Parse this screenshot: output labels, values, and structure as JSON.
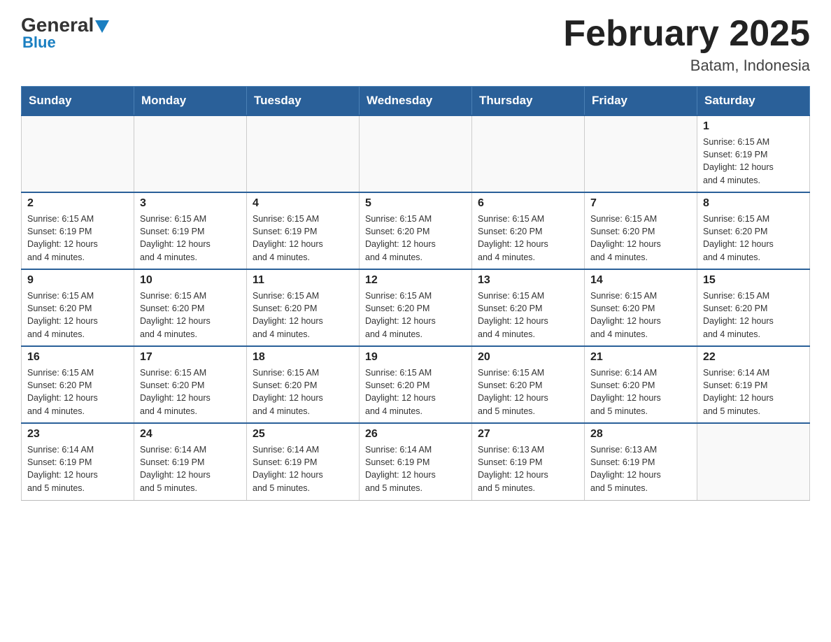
{
  "header": {
    "logo_general": "General",
    "logo_blue": "Blue",
    "month_title": "February 2025",
    "location": "Batam, Indonesia"
  },
  "days_of_week": [
    "Sunday",
    "Monday",
    "Tuesday",
    "Wednesday",
    "Thursday",
    "Friday",
    "Saturday"
  ],
  "weeks": [
    [
      {
        "day": "",
        "info": ""
      },
      {
        "day": "",
        "info": ""
      },
      {
        "day": "",
        "info": ""
      },
      {
        "day": "",
        "info": ""
      },
      {
        "day": "",
        "info": ""
      },
      {
        "day": "",
        "info": ""
      },
      {
        "day": "1",
        "info": "Sunrise: 6:15 AM\nSunset: 6:19 PM\nDaylight: 12 hours\nand 4 minutes."
      }
    ],
    [
      {
        "day": "2",
        "info": "Sunrise: 6:15 AM\nSunset: 6:19 PM\nDaylight: 12 hours\nand 4 minutes."
      },
      {
        "day": "3",
        "info": "Sunrise: 6:15 AM\nSunset: 6:19 PM\nDaylight: 12 hours\nand 4 minutes."
      },
      {
        "day": "4",
        "info": "Sunrise: 6:15 AM\nSunset: 6:19 PM\nDaylight: 12 hours\nand 4 minutes."
      },
      {
        "day": "5",
        "info": "Sunrise: 6:15 AM\nSunset: 6:20 PM\nDaylight: 12 hours\nand 4 minutes."
      },
      {
        "day": "6",
        "info": "Sunrise: 6:15 AM\nSunset: 6:20 PM\nDaylight: 12 hours\nand 4 minutes."
      },
      {
        "day": "7",
        "info": "Sunrise: 6:15 AM\nSunset: 6:20 PM\nDaylight: 12 hours\nand 4 minutes."
      },
      {
        "day": "8",
        "info": "Sunrise: 6:15 AM\nSunset: 6:20 PM\nDaylight: 12 hours\nand 4 minutes."
      }
    ],
    [
      {
        "day": "9",
        "info": "Sunrise: 6:15 AM\nSunset: 6:20 PM\nDaylight: 12 hours\nand 4 minutes."
      },
      {
        "day": "10",
        "info": "Sunrise: 6:15 AM\nSunset: 6:20 PM\nDaylight: 12 hours\nand 4 minutes."
      },
      {
        "day": "11",
        "info": "Sunrise: 6:15 AM\nSunset: 6:20 PM\nDaylight: 12 hours\nand 4 minutes."
      },
      {
        "day": "12",
        "info": "Sunrise: 6:15 AM\nSunset: 6:20 PM\nDaylight: 12 hours\nand 4 minutes."
      },
      {
        "day": "13",
        "info": "Sunrise: 6:15 AM\nSunset: 6:20 PM\nDaylight: 12 hours\nand 4 minutes."
      },
      {
        "day": "14",
        "info": "Sunrise: 6:15 AM\nSunset: 6:20 PM\nDaylight: 12 hours\nand 4 minutes."
      },
      {
        "day": "15",
        "info": "Sunrise: 6:15 AM\nSunset: 6:20 PM\nDaylight: 12 hours\nand 4 minutes."
      }
    ],
    [
      {
        "day": "16",
        "info": "Sunrise: 6:15 AM\nSunset: 6:20 PM\nDaylight: 12 hours\nand 4 minutes."
      },
      {
        "day": "17",
        "info": "Sunrise: 6:15 AM\nSunset: 6:20 PM\nDaylight: 12 hours\nand 4 minutes."
      },
      {
        "day": "18",
        "info": "Sunrise: 6:15 AM\nSunset: 6:20 PM\nDaylight: 12 hours\nand 4 minutes."
      },
      {
        "day": "19",
        "info": "Sunrise: 6:15 AM\nSunset: 6:20 PM\nDaylight: 12 hours\nand 4 minutes."
      },
      {
        "day": "20",
        "info": "Sunrise: 6:15 AM\nSunset: 6:20 PM\nDaylight: 12 hours\nand 5 minutes."
      },
      {
        "day": "21",
        "info": "Sunrise: 6:14 AM\nSunset: 6:20 PM\nDaylight: 12 hours\nand 5 minutes."
      },
      {
        "day": "22",
        "info": "Sunrise: 6:14 AM\nSunset: 6:19 PM\nDaylight: 12 hours\nand 5 minutes."
      }
    ],
    [
      {
        "day": "23",
        "info": "Sunrise: 6:14 AM\nSunset: 6:19 PM\nDaylight: 12 hours\nand 5 minutes."
      },
      {
        "day": "24",
        "info": "Sunrise: 6:14 AM\nSunset: 6:19 PM\nDaylight: 12 hours\nand 5 minutes."
      },
      {
        "day": "25",
        "info": "Sunrise: 6:14 AM\nSunset: 6:19 PM\nDaylight: 12 hours\nand 5 minutes."
      },
      {
        "day": "26",
        "info": "Sunrise: 6:14 AM\nSunset: 6:19 PM\nDaylight: 12 hours\nand 5 minutes."
      },
      {
        "day": "27",
        "info": "Sunrise: 6:13 AM\nSunset: 6:19 PM\nDaylight: 12 hours\nand 5 minutes."
      },
      {
        "day": "28",
        "info": "Sunrise: 6:13 AM\nSunset: 6:19 PM\nDaylight: 12 hours\nand 5 minutes."
      },
      {
        "day": "",
        "info": ""
      }
    ]
  ]
}
